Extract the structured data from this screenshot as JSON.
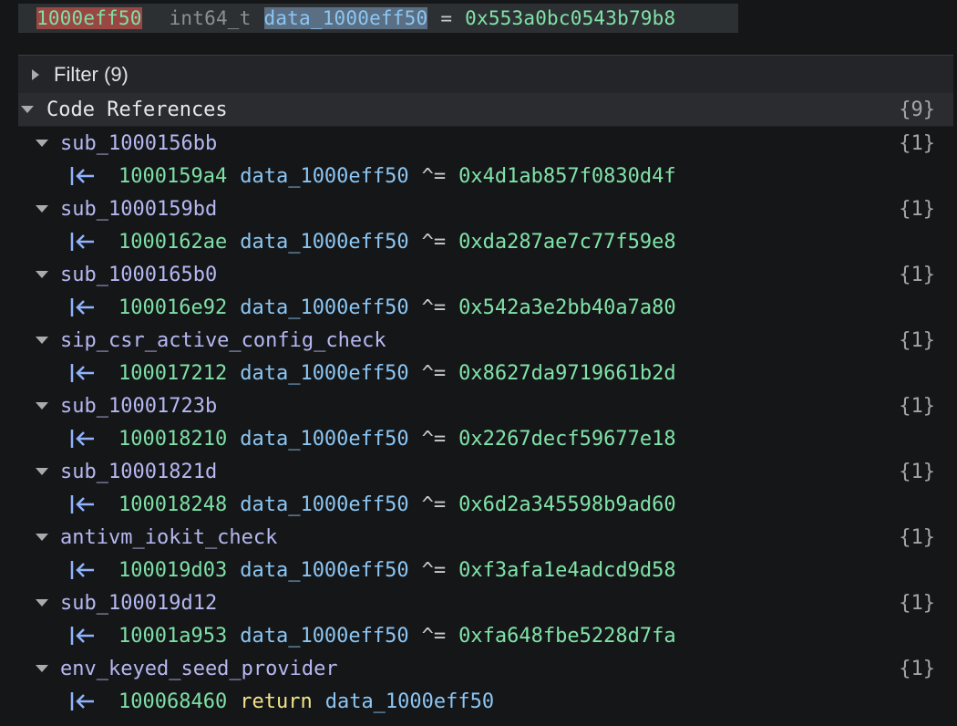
{
  "codebar": {
    "address": "1000eff50",
    "type": "int64_t",
    "variable": "data_1000eff50",
    "equals": "=",
    "value": "0x553a0bc0543b79b8"
  },
  "filter": {
    "label": "Filter (9)"
  },
  "code_references": {
    "label": "Code References",
    "count": "{9}",
    "functions": [
      {
        "name": "sub_1000156bb",
        "count": "{1}",
        "ref": {
          "address": "1000159a4",
          "keyword": "",
          "variable": "data_1000eff50",
          "operator": "^=",
          "value": "0x4d1ab857f0830d4f"
        }
      },
      {
        "name": "sub_1000159bd",
        "count": "{1}",
        "ref": {
          "address": "1000162ae",
          "keyword": "",
          "variable": "data_1000eff50",
          "operator": "^=",
          "value": "0xda287ae7c77f59e8"
        }
      },
      {
        "name": "sub_1000165b0",
        "count": "{1}",
        "ref": {
          "address": "100016e92",
          "keyword": "",
          "variable": "data_1000eff50",
          "operator": "^=",
          "value": "0x542a3e2bb40a7a80"
        }
      },
      {
        "name": "sip_csr_active_config_check",
        "count": "{1}",
        "ref": {
          "address": "100017212",
          "keyword": "",
          "variable": "data_1000eff50",
          "operator": "^=",
          "value": "0x8627da9719661b2d"
        }
      },
      {
        "name": "sub_10001723b",
        "count": "{1}",
        "ref": {
          "address": "100018210",
          "keyword": "",
          "variable": "data_1000eff50",
          "operator": "^=",
          "value": "0x2267decf59677e18"
        }
      },
      {
        "name": "sub_10001821d",
        "count": "{1}",
        "ref": {
          "address": "100018248",
          "keyword": "",
          "variable": "data_1000eff50",
          "operator": "^=",
          "value": "0x6d2a345598b9ad60"
        }
      },
      {
        "name": "antivm_iokit_check",
        "count": "{1}",
        "ref": {
          "address": "100019d03",
          "keyword": "",
          "variable": "data_1000eff50",
          "operator": "^=",
          "value": "0xf3afa1e4adcd9d58"
        }
      },
      {
        "name": "sub_100019d12",
        "count": "{1}",
        "ref": {
          "address": "10001a953",
          "keyword": "",
          "variable": "data_1000eff50",
          "operator": "^=",
          "value": "0xfa648fbe5228d7fa"
        }
      },
      {
        "name": "env_keyed_seed_provider",
        "count": "{1}",
        "ref": {
          "address": "100068460",
          "keyword": "return",
          "variable": "data_1000eff50",
          "operator": "",
          "value": ""
        }
      }
    ]
  },
  "icons": {
    "collapsed": "triangle-right-icon",
    "expanded": "triangle-down-icon",
    "xref": "arrow-left-bar-icon"
  },
  "colors": {
    "background": "#151618",
    "address": "#7ee0a6",
    "variable": "#8cc6f3",
    "function": "#b6b8f1",
    "keyword": "#f1e48a",
    "xref_icon": "#8fb3ff"
  }
}
